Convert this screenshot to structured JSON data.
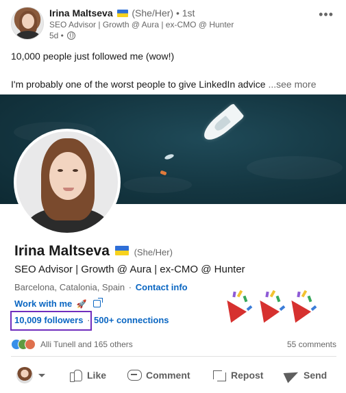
{
  "header": {
    "author_name": "Irina Maltseva",
    "pronouns": "(She/Her)",
    "connection_degree": "• 1st",
    "headline": "SEO Advisor | Growth @ Aura | ex-CMO @ Hunter",
    "time": "5d •",
    "more_label": "•••"
  },
  "post": {
    "line1": "10,000 people just followed me (wow!)",
    "line2": "I'm probably one of the worst people to give LinkedIn advice",
    "see_more": "...see more"
  },
  "profile_card": {
    "name": "Irina Maltseva",
    "pronouns": "(She/Her)",
    "headline": "SEO Advisor | Growth @ Aura | ex-CMO @ Hunter",
    "location": "Barcelona, Catalonia, Spain",
    "location_sep": "·",
    "contact_info": "Contact info",
    "work_with_me": "Work with me",
    "rocket": "🚀",
    "followers": "10,009 followers",
    "stats_sep": "·",
    "connections": "500+ connections"
  },
  "social": {
    "reactions_text": "Alli Tunell and 165 others",
    "comments": "55 comments"
  },
  "actions": {
    "like": "Like",
    "comment": "Comment",
    "repost": "Repost",
    "send": "Send"
  },
  "colors": {
    "link": "#0a66c2",
    "highlight_box": "#6f2dbd",
    "banner": "#143641",
    "party_popper": "#d6312f"
  }
}
